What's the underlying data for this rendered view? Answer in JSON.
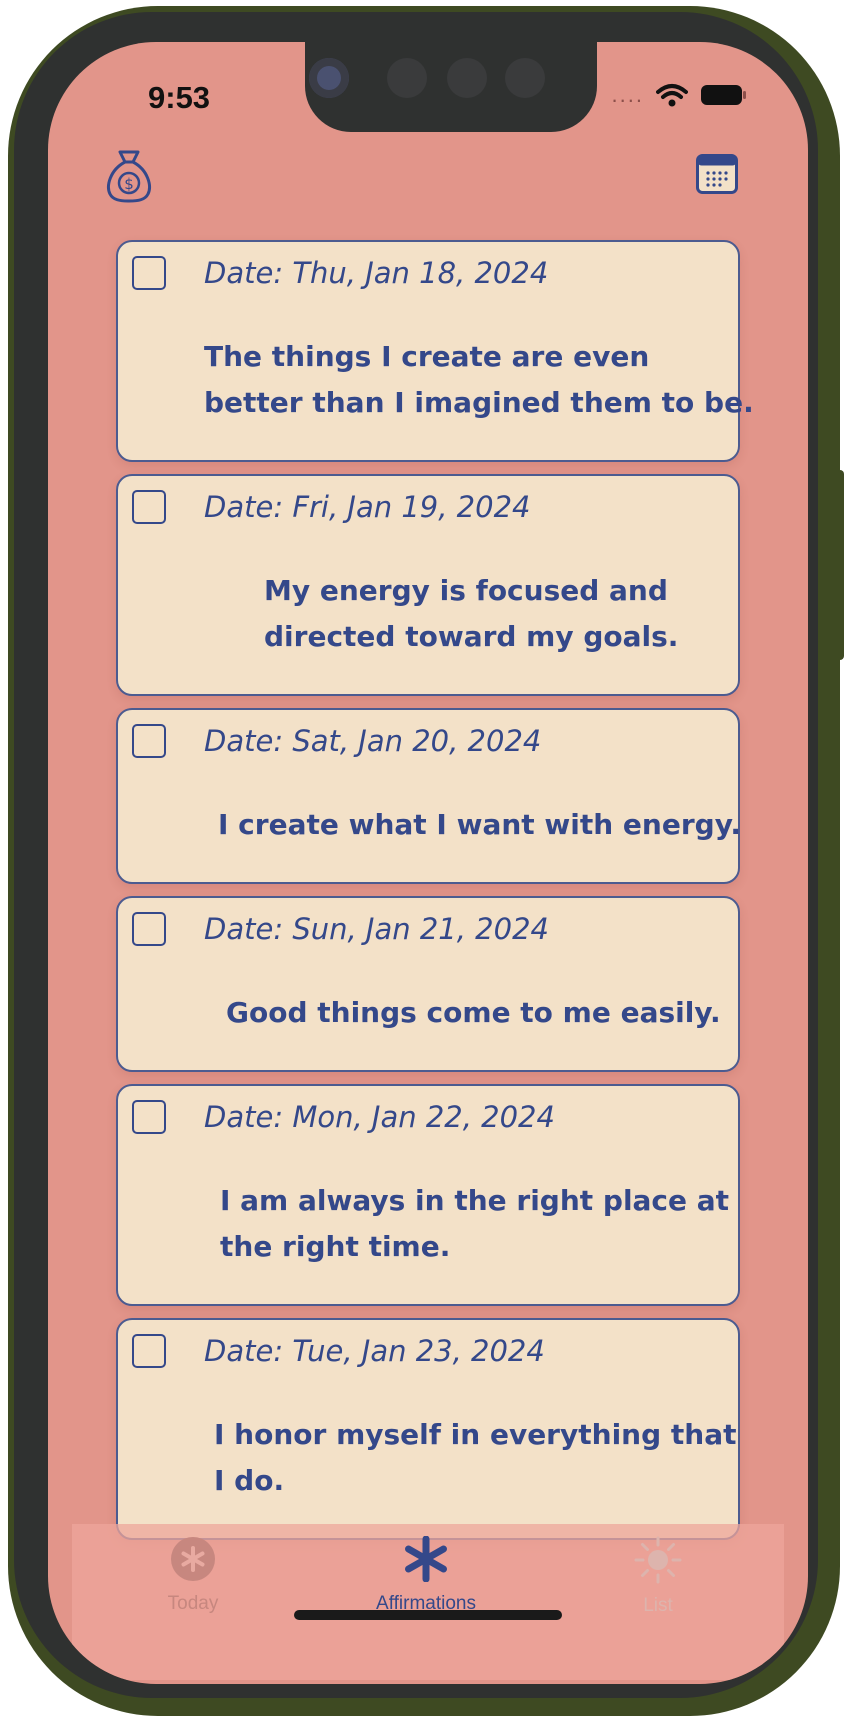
{
  "status_bar": {
    "time": "9:53",
    "signal_dots": "...."
  },
  "colors": {
    "screen_background": "#e2958a",
    "card_background": "#f3e1c8",
    "accent": "#34488a",
    "tab_inactive": "#c7877f"
  },
  "header": {
    "left_icon": "money-bag-icon",
    "right_icon": "calendar-icon"
  },
  "affirmations": [
    {
      "date_prefix": "Date: ",
      "date": "Thu, Jan 18, 2024",
      "text_line1": "The things I create are even",
      "text_line2": "better than I imagined them to be.",
      "checked": false
    },
    {
      "date_prefix": "Date: ",
      "date": "Fri, Jan 19, 2024",
      "text_line1": "My energy is focused and",
      "text_line2": "directed toward my goals.",
      "checked": false
    },
    {
      "date_prefix": "Date: ",
      "date": "Sat, Jan 20, 2024",
      "text_line1": "I create what I want with energy.",
      "text_line2": "",
      "checked": false
    },
    {
      "date_prefix": "Date: ",
      "date": "Sun, Jan 21, 2024",
      "text_line1": "Good things come to me easily.",
      "text_line2": "",
      "checked": false
    },
    {
      "date_prefix": "Date: ",
      "date": "Mon, Jan 22, 2024",
      "text_line1": "I am always in the right place at",
      "text_line2": "the right time.",
      "checked": false
    },
    {
      "date_prefix": "Date: ",
      "date": "Tue, Jan 23, 2024",
      "text_line1": "I honor myself in everything that",
      "text_line2": "I do.",
      "checked": false
    }
  ],
  "tabbar": {
    "tabs": [
      {
        "label": "Today",
        "icon": "asterisk-circle-icon",
        "selected": false
      },
      {
        "label": "Affirmations",
        "icon": "asterisk-icon",
        "selected": true
      },
      {
        "label": "List",
        "icon": "sun-icon",
        "selected": false
      }
    ]
  }
}
